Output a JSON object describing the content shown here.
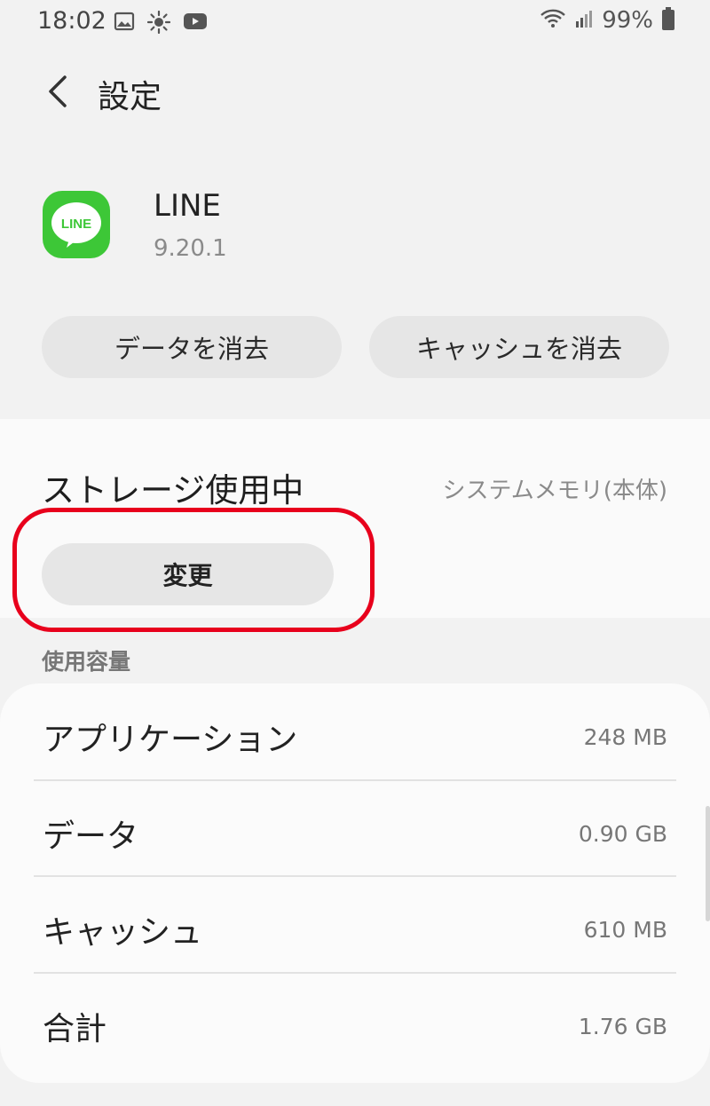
{
  "status_bar": {
    "time": "18:02",
    "battery_percent": "99%",
    "left_icons": [
      "gallery-icon",
      "brightness-icon",
      "youtube-icon"
    ],
    "right_icons": [
      "wifi-icon",
      "signal-icon",
      "battery-icon"
    ]
  },
  "header": {
    "title": "設定"
  },
  "app": {
    "name": "LINE",
    "version": "9.20.1",
    "icon_text": "LINE",
    "icon_color": "#3dc737"
  },
  "actions": {
    "clear_data": "データを消去",
    "clear_cache": "キャッシュを消去"
  },
  "storage": {
    "label": "ストレージ使用中",
    "location": "システムメモリ(本体)",
    "change_button": "変更"
  },
  "usage": {
    "header": "使用容量",
    "rows": [
      {
        "label": "アプリケーション",
        "value": "248 MB"
      },
      {
        "label": "データ",
        "value": "0.90 GB"
      },
      {
        "label": "キャッシュ",
        "value": "610 MB"
      },
      {
        "label": "合計",
        "value": "1.76 GB"
      }
    ]
  },
  "colors": {
    "highlight": "#e8001c",
    "background": "#f2f2f2"
  }
}
